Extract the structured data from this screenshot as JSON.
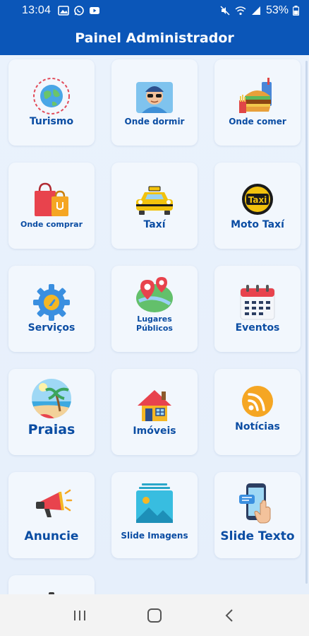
{
  "status_bar": {
    "time": "13:04",
    "battery": "53%"
  },
  "app_bar": {
    "title": "Painel Administrador"
  },
  "tiles": [
    {
      "label": "Turismo",
      "icon": "globe-icon"
    },
    {
      "label": "Onde dormir",
      "icon": "sleeping-person-icon"
    },
    {
      "label": "Onde comer",
      "icon": "food-icon"
    },
    {
      "label": "Onde comprar",
      "icon": "shopping-bags-icon"
    },
    {
      "label": "Taxí",
      "icon": "taxi-car-icon"
    },
    {
      "label": "Moto Taxí",
      "icon": "taxi-badge-icon"
    },
    {
      "label": "Serviços",
      "icon": "gear-icon"
    },
    {
      "label": "Lugares Públicos",
      "icon": "map-pins-icon"
    },
    {
      "label": "Eventos",
      "icon": "calendar-icon"
    },
    {
      "label": "Praias",
      "icon": "beach-icon"
    },
    {
      "label": "Imóveis",
      "icon": "house-icon"
    },
    {
      "label": "Notícias",
      "icon": "rss-icon"
    },
    {
      "label": "Anuncie",
      "icon": "megaphone-icon"
    },
    {
      "label": "Slide Imagens",
      "icon": "image-slide-icon"
    },
    {
      "label": "Slide Texto",
      "icon": "phone-chat-icon"
    }
  ]
}
